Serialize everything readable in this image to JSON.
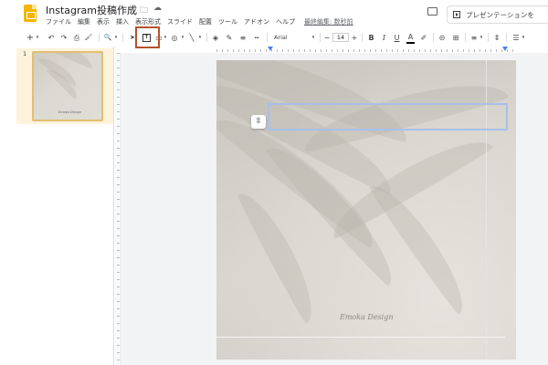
{
  "doc": {
    "title": "Instagram投稿作成",
    "star_icon": "☆",
    "folder_icon": "🗀",
    "cloud_icon": "☁"
  },
  "menu": {
    "items": [
      "ファイル",
      "編集",
      "表示",
      "挿入",
      "表示形式",
      "スライド",
      "配置",
      "ツール",
      "アドオン",
      "ヘルプ"
    ],
    "last_edit": "最終編集: 数秒前"
  },
  "present": {
    "label": "プレゼンテーションを"
  },
  "toolbar": {
    "add": "+",
    "undo": "↶",
    "redo": "↷",
    "print": "⎙",
    "paint_format": "🖌",
    "zoom": "🔍",
    "select": "➤",
    "textbox": "T",
    "font": "Arial",
    "font_size": "14",
    "minus": "−",
    "plus": "+",
    "bold": "B",
    "italic": "I",
    "underline": "U",
    "text_color": "A",
    "link": "⊝",
    "comment": "⊞",
    "align": "≡",
    "line_spacing": "⇕",
    "list": "☰"
  },
  "slides": [
    {
      "number": "1",
      "caption": "Emoka Design"
    }
  ],
  "slide": {
    "signature": "Emoka Design",
    "align_icon": "⇳"
  },
  "colors": {
    "accent_yellow": "#f4b400",
    "selection_border": "#a7c0e8",
    "highlight": "#b4522c",
    "ruler_marker": "#4a86e8"
  }
}
